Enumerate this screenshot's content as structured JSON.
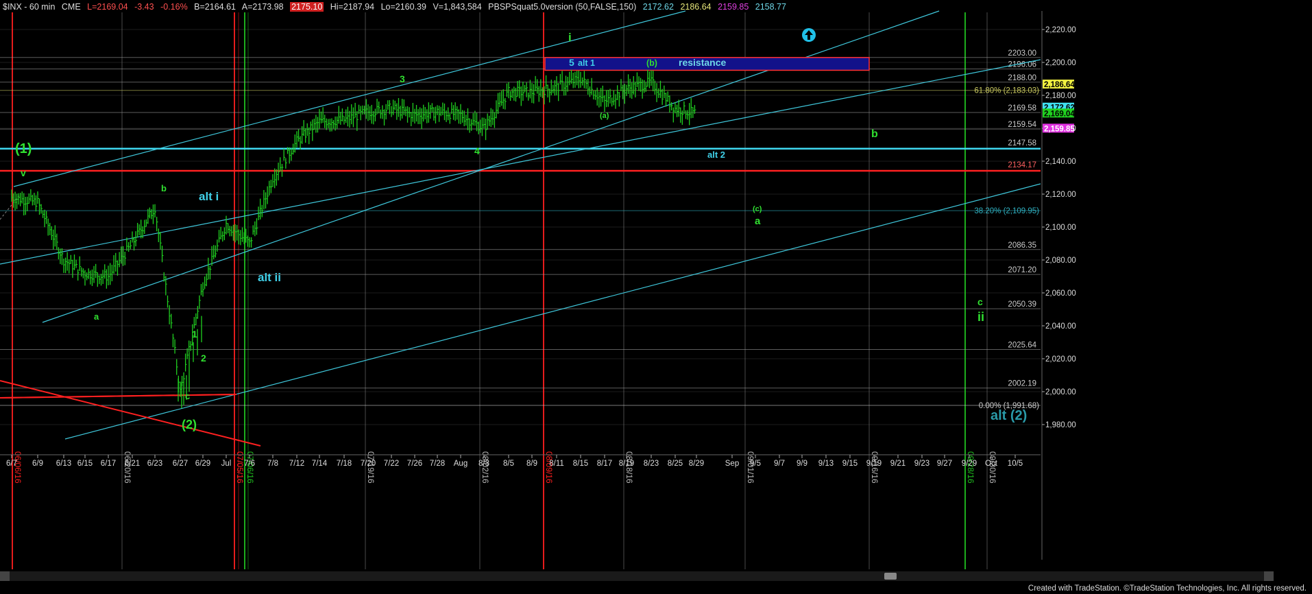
{
  "header": {
    "symbol": "$INX - 60 min",
    "exchange": "CME",
    "last": "L=2169.04",
    "change": "-3.43",
    "change_pct": "-0.16%",
    "bid": "B=2164.61",
    "ask": "A=2173.98",
    "ask_extra": "2175.10",
    "high": "Hi=2187.94",
    "low": "Lo=2160.39",
    "volume": "V=1,843,584",
    "indicator": "PBSPSquat5.0version (50,FALSE,150)",
    "ind_values": [
      {
        "text": "2172.62",
        "color": "#6fd8e8"
      },
      {
        "text": "2186.64",
        "color": "#e6e67a"
      },
      {
        "text": "2159.85",
        "color": "#e040e0"
      },
      {
        "text": "2158.77",
        "color": "#6fd8e8"
      }
    ]
  },
  "footer": "Created with TradeStation. ©TradeStation Technologies, Inc. All rights reserved.",
  "chart_data": {
    "type": "candlestick",
    "timeframe": "60 min",
    "ylim": [
      1970,
      2230
    ],
    "y_ticks": [
      1980,
      2000,
      2020,
      2040,
      2060,
      2080,
      2100,
      2120,
      2140,
      2160,
      2180,
      2200,
      2220
    ],
    "x_labels": [
      "6/7",
      "6/9",
      "6/13",
      "6/15",
      "6/17",
      "6/21",
      "6/23",
      "6/27",
      "6/29",
      "Jul",
      "7/6",
      "7/8",
      "7/12",
      "7/14",
      "7/18",
      "7/20",
      "7/22",
      "7/26",
      "7/28",
      "Aug",
      "8/3",
      "8/5",
      "8/9",
      "8/11",
      "8/15",
      "8/17",
      "8/19",
      "8/23",
      "8/25",
      "8/29",
      "Sep",
      "9/5",
      "9/7",
      "9/9",
      "9/13",
      "9/15",
      "9/19",
      "9/21",
      "9/23",
      "9/27",
      "9/29",
      "Oct",
      "10/5"
    ],
    "session_ohlc_approx": [
      {
        "date": "6/7",
        "close": 2118
      },
      {
        "date": "6/9",
        "close": 2115
      },
      {
        "date": "6/13",
        "close": 2080
      },
      {
        "date": "6/15",
        "close": 2072
      },
      {
        "date": "6/17",
        "close": 2070
      },
      {
        "date": "6/21",
        "close": 2090
      },
      {
        "date": "6/23",
        "close": 2112
      },
      {
        "date": "6/27",
        "close": 2000
      },
      {
        "date": "6/29",
        "close": 2065
      },
      {
        "date": "Jul",
        "close": 2102
      },
      {
        "date": "7/6",
        "close": 2090
      },
      {
        "date": "7/8",
        "close": 2130
      },
      {
        "date": "7/12",
        "close": 2152
      },
      {
        "date": "7/14",
        "close": 2164
      },
      {
        "date": "7/18",
        "close": 2165
      },
      {
        "date": "7/20",
        "close": 2170
      },
      {
        "date": "7/22",
        "close": 2172
      },
      {
        "date": "7/26",
        "close": 2168
      },
      {
        "date": "7/28",
        "close": 2170
      },
      {
        "date": "Aug",
        "close": 2168
      },
      {
        "date": "8/3",
        "close": 2160
      },
      {
        "date": "8/5",
        "close": 2182
      },
      {
        "date": "8/9",
        "close": 2182
      },
      {
        "date": "8/11",
        "close": 2185
      },
      {
        "date": "8/15",
        "close": 2190
      },
      {
        "date": "8/17",
        "close": 2176
      },
      {
        "date": "8/19",
        "close": 2184
      },
      {
        "date": "8/23",
        "close": 2188
      },
      {
        "date": "8/25",
        "close": 2172
      },
      {
        "date": "8/29",
        "close": 2169
      }
    ],
    "horizontal_levels": [
      {
        "value": 2203.0,
        "label": "2203.00"
      },
      {
        "value": 2196.06,
        "label": "2196.06"
      },
      {
        "value": 2188.0,
        "label": "2188.00"
      },
      {
        "value": 2169.58,
        "label": "2169.58"
      },
      {
        "value": 2159.54,
        "label": "2159.54"
      },
      {
        "value": 2086.35,
        "label": "2086.35"
      },
      {
        "value": 2071.2,
        "label": "2071.20"
      },
      {
        "value": 2050.39,
        "label": "2050.39"
      },
      {
        "value": 2025.64,
        "label": "2025.64"
      },
      {
        "value": 2002.19,
        "label": "2002.19"
      }
    ],
    "key_levels": [
      {
        "value": 2147.58,
        "label": "2147.58",
        "color": "#3fd8f0"
      },
      {
        "value": 2134.17,
        "label": "2134.17",
        "color": "#ff2020"
      }
    ],
    "fib_levels": [
      {
        "value": 2183.03,
        "label": "61.80% (2,183.03)",
        "color": "#c8c860"
      },
      {
        "value": 2109.95,
        "label": "38.20% (2,109.95)",
        "color": "#2fb0c0"
      },
      {
        "value": 1991.68,
        "label": "0.00% (1,991.68)",
        "color": "#ccc"
      }
    ],
    "price_tags": [
      {
        "value": 2186.64,
        "label": "2,186.64",
        "bg": "#f0f040",
        "fg": "#000"
      },
      {
        "value": 2172.62,
        "label": "2,172.62",
        "bg": "#40e0f0",
        "fg": "#000"
      },
      {
        "value": 2169.04,
        "label": "2,169.04",
        "bg": "#20d020",
        "fg": "#000"
      },
      {
        "value": 2159.85,
        "label": "2,159.85",
        "bg": "#e030e0",
        "fg": "#fff"
      }
    ],
    "resistance_zone": {
      "y_from": 2196.06,
      "y_to": 2203.0,
      "label": "resistance",
      "sublabels": [
        "5",
        "alt 1",
        "(b)"
      ]
    },
    "vertical_lines": [
      {
        "date": "06/06/16",
        "color": "#ff2020"
      },
      {
        "date": "06/20/16",
        "color": "#888"
      },
      {
        "date": "07/05/16",
        "color": "#ff2020"
      },
      {
        "date": "07/06/16",
        "color": "#20c020"
      },
      {
        "date": "07/19/16",
        "color": "#888"
      },
      {
        "date": "08/02/16",
        "color": "#888"
      },
      {
        "date": "08/09/16",
        "color": "#ff2020"
      },
      {
        "date": "08/18/16",
        "color": "#888"
      },
      {
        "date": "09/01/16",
        "color": "#888"
      },
      {
        "date": "09/16/16",
        "color": "#888"
      },
      {
        "date": "09/28/16",
        "color": "#20c020"
      },
      {
        "date": "09/30/16",
        "color": "#888"
      }
    ],
    "wave_labels": [
      {
        "text": "(1)",
        "color": "#30e030"
      },
      {
        "text": "v",
        "color": "#30e030"
      },
      {
        "text": "a",
        "color": "#30e030"
      },
      {
        "text": "b",
        "color": "#30e030"
      },
      {
        "text": "alt i",
        "color": "#40d0e8"
      },
      {
        "text": "alt ii",
        "color": "#40d0e8"
      },
      {
        "text": "1",
        "color": "#30e030"
      },
      {
        "text": "2",
        "color": "#30e030"
      },
      {
        "text": "c",
        "color": "#30e030"
      },
      {
        "text": "(2)",
        "color": "#30e030"
      },
      {
        "text": "3",
        "color": "#30e030"
      },
      {
        "text": "4",
        "color": "#30e030"
      },
      {
        "text": "i",
        "color": "#30e030"
      },
      {
        "text": "(a)",
        "color": "#30e030"
      },
      {
        "text": "alt 2",
        "color": "#40d0e8"
      },
      {
        "text": "(c)",
        "color": "#30e030"
      },
      {
        "text": "a",
        "color": "#30e030"
      },
      {
        "text": "b",
        "color": "#30e030"
      },
      {
        "text": "c",
        "color": "#30e030"
      },
      {
        "text": "ii",
        "color": "#30e030"
      },
      {
        "text": "alt (2)",
        "color": "#2a9aa8"
      }
    ]
  }
}
